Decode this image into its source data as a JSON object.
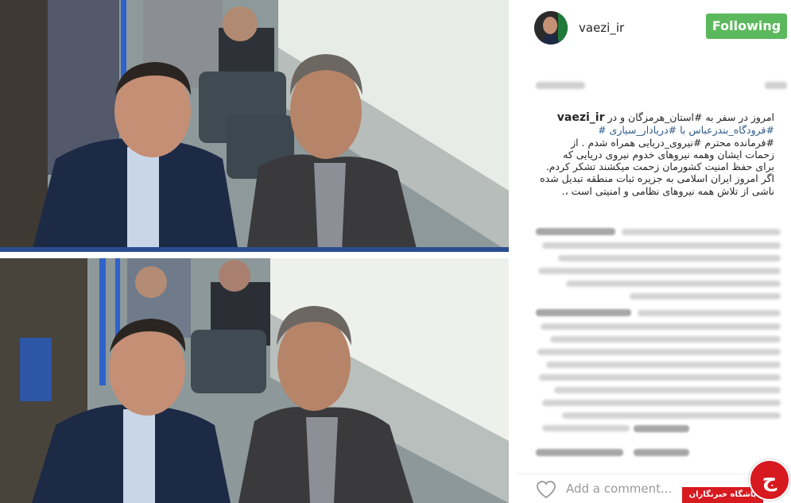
{
  "post": {
    "username": "vaezi_ir",
    "follow_label": "Following",
    "caption_user": "vaezi_ir",
    "caption_lines": [
      "امروز در سفر به #استان_هرمزگان و در",
      "#فرودگاه_بندرعباس با #دریادار_سیاری #",
      "#فرمانده محترم #نیروی_دریایی همراه شدم . از",
      "زحمات ایشان وهمه نیروهای خدوم نیروی دریایی که",
      "برای حفظ امنیت کشورمان زحمت میکشند تشکر کردم.",
      "اگر امروز ایران اسلامی به جزیره ثبات منطقه تبدیل شده",
      "ناشی از تلاش همه نیروهای نظامی و امنیتی است ،."
    ],
    "add_comment_placeholder": "Add a comment...",
    "heart_icon": "heart-outline-icon"
  },
  "watermark": {
    "label": "باشگاه خبرنگاران",
    "logo_glyph": "ج"
  },
  "colors": {
    "following_green": "#5cb85c",
    "hashtag_blue": "#2f5b8a",
    "badge_red": "#d71920"
  }
}
